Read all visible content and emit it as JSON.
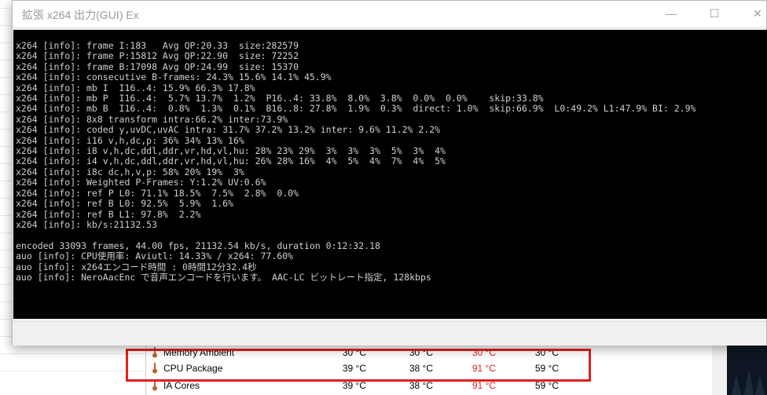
{
  "window": {
    "title": "拡張 x264 出力(GUI) Ex",
    "min_glyph": "—",
    "max_glyph": "☐",
    "close_glyph": "✕"
  },
  "console_lines": [
    "x264 [info]: frame I:183   Avg QP:20.33  size:282579",
    "x264 [info]: frame P:15812 Avg QP:22.90  size: 72252",
    "x264 [info]: frame B:17098 Avg QP:24.99  size: 15370",
    "x264 [info]: consecutive B-frames: 24.3% 15.6% 14.1% 45.9%",
    "x264 [info]: mb I  I16..4: 15.9% 66.3% 17.8%",
    "x264 [info]: mb P  I16..4:  5.7% 13.7%  1.2%  P16..4: 33.8%  8.0%  3.8%  0.0%  0.0%    skip:33.8%",
    "x264 [info]: mb B  I16..4:  0.8%  1.3%  0.1%  B16..8: 27.8%  1.9%  0.3%  direct: 1.0%  skip:66.9%  L0:49.2% L1:47.9% BI: 2.9%",
    "x264 [info]: 8x8 transform intra:66.2% inter:73.9%",
    "x264 [info]: coded y,uvDC,uvAC intra: 31.7% 37.2% 13.2% inter: 9.6% 11.2% 2.2%",
    "x264 [info]: i16 v,h,dc,p: 36% 34% 13% 16%",
    "x264 [info]: i8 v,h,dc,ddl,ddr,vr,hd,vl,hu: 28% 23% 29%  3%  3%  3%  5%  3%  4%",
    "x264 [info]: i4 v,h,dc,ddl,ddr,vr,hd,vl,hu: 26% 28% 16%  4%  5%  4%  7%  4%  5%",
    "x264 [info]: i8c dc,h,v,p: 58% 20% 19%  3%",
    "x264 [info]: Weighted P-Frames: Y:1.2% UV:0.6%",
    "x264 [info]: ref P L0: 71.1% 18.5%  7.5%  2.8%  0.0%",
    "x264 [info]: ref B L0: 92.5%  5.9%  1.6%",
    "x264 [info]: ref B L1: 97.8%  2.2%",
    "x264 [info]: kb/s:21132.53",
    "",
    "encoded 33093 frames, 44.00 fps, 21132.54 kb/s, duration 0:12:32.18",
    "auo [info]: CPU使用率: Aviutl: 14.33% / x264: 77.60%",
    "auo [info]: x264エンコード時間 : 0時間12分32.4秒",
    "auo [info]: NeroAacEnc で音声エンコードを行います。 AAC-LC ビットレート指定, 128kbps"
  ],
  "sensors": [
    {
      "label": "Memory Ambient",
      "cur": "30 °C",
      "min": "30 °C",
      "max": "30 °C",
      "avg": "30 °C"
    },
    {
      "label": "CPU Package",
      "cur": "39 °C",
      "min": "38 °C",
      "max": "91 °C",
      "avg": "59 °C"
    },
    {
      "label": "IA Cores",
      "cur": "39 °C",
      "min": "38 °C",
      "max": "91 °C",
      "avg": "59 °C"
    }
  ],
  "colors": {
    "max_value": "#e02020",
    "highlight_border": "#e02020",
    "console_bg": "#000000",
    "console_text": "#d0d0d0"
  }
}
